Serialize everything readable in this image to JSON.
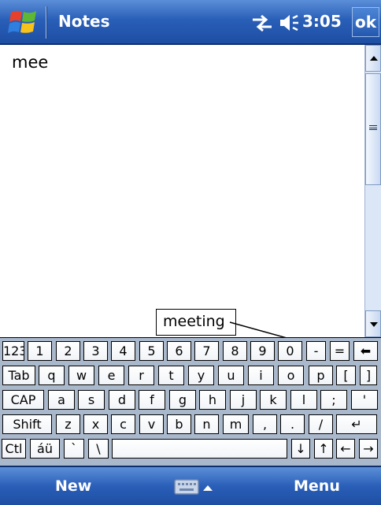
{
  "title_bar": {
    "app_title": "Notes",
    "time": "3:05",
    "ok_label": "ok",
    "icons": [
      "windows-start-icon",
      "connectivity-icon",
      "volume-icon"
    ]
  },
  "document": {
    "text": "mee"
  },
  "suggestion": {
    "word": "meeting"
  },
  "keyboard": {
    "rows": [
      [
        "123",
        "1",
        "2",
        "3",
        "4",
        "5",
        "6",
        "7",
        "8",
        "9",
        "0",
        "-",
        "=",
        "⬅"
      ],
      [
        "Tab",
        "q",
        "w",
        "e",
        "r",
        "t",
        "y",
        "u",
        "i",
        "o",
        "p",
        "[",
        "]"
      ],
      [
        "CAP",
        "a",
        "s",
        "d",
        "f",
        "g",
        "h",
        "j",
        "k",
        "l",
        ";",
        "'"
      ],
      [
        "Shift",
        "z",
        "x",
        "c",
        "v",
        "b",
        "n",
        "m",
        ",",
        ".",
        "/",
        "↵"
      ],
      [
        "Ctl",
        "áü",
        "`",
        "\\",
        "",
        "↓",
        "↑",
        "←",
        "→"
      ]
    ]
  },
  "menu_bar": {
    "new_label": "New",
    "menu_label": "Menu",
    "sip_icon": "keyboard-icon"
  },
  "colors": {
    "title_bar": "#2a5fb8",
    "keyboard_bg": "#aab8cc"
  }
}
